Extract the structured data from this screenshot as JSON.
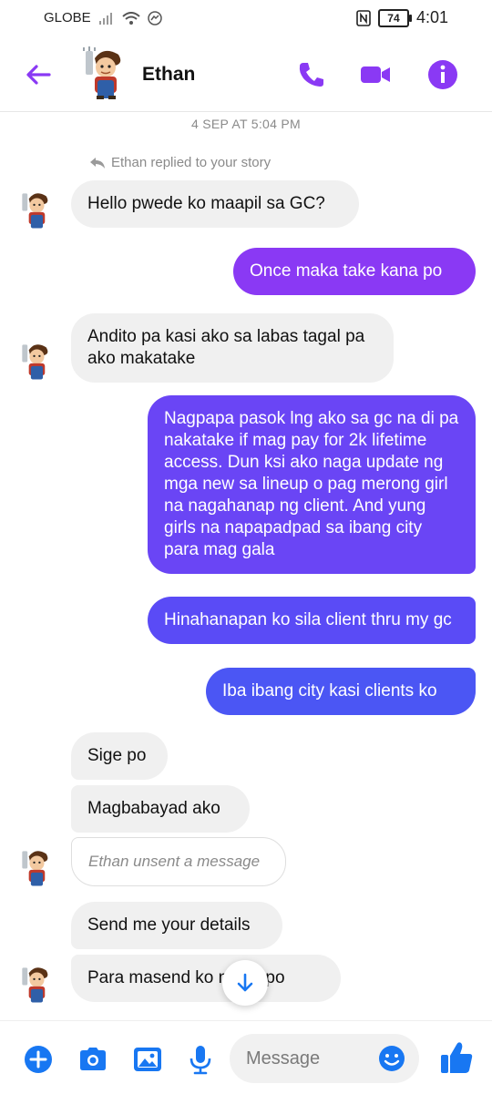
{
  "status": {
    "carrier": "GLOBE",
    "battery": "74",
    "time": "4:01"
  },
  "header": {
    "contact_name": "Ethan"
  },
  "chat": {
    "timestamp": "4 SEP AT 5:04 PM",
    "reply_note": "Ethan replied to your story",
    "messages": [
      {
        "from": "in",
        "text": "Hello pwede ko maapil sa GC?"
      },
      {
        "from": "out",
        "text": "Once maka take kana po"
      },
      {
        "from": "in",
        "text": "Andito pa kasi ako sa labas tagal pa ako makatake"
      },
      {
        "from": "out",
        "text": "Nagpapa pasok lng ako sa gc na di pa nakatake if mag pay for 2k lifetime access. Dun ksi ako naga update ng mga new sa lineup o pag merong girl na nagahanap ng client. And yung girls na napapadpad sa ibang city para mag gala"
      },
      {
        "from": "out",
        "text": "Hinahanapan ko sila client thru my gc"
      },
      {
        "from": "out",
        "text": "Iba ibang city kasi clients ko"
      },
      {
        "from": "in",
        "text": "Sige po"
      },
      {
        "from": "in",
        "text": "Magbabayad ako"
      },
      {
        "from": "in",
        "text": "Ethan unsent a message"
      },
      {
        "from": "in",
        "text": "Send me your details"
      },
      {
        "from": "in",
        "text": "Para masend ko na 2k po"
      }
    ]
  },
  "composer": {
    "placeholder": "Message"
  },
  "colors": {
    "accent": "#8a39f4",
    "bubble_in": "#f0f0f0",
    "icon_blue": "#1877f2"
  }
}
